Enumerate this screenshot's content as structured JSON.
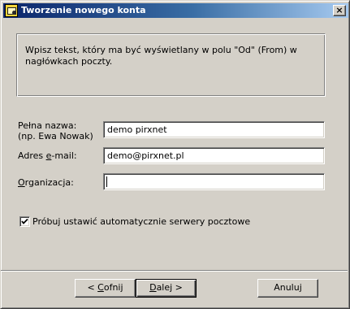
{
  "window": {
    "title": "Tworzenie nowego konta",
    "close_glyph": "×"
  },
  "info": {
    "text": "Wpisz tekst, który ma być wyświetlany w polu \"Od\" (From) w nagłówkach poczty."
  },
  "form": {
    "full_name": {
      "label_line1": "Pełna nazwa:",
      "label_line2": "(np. Ewa Nowak)",
      "value": "demo pirxnet"
    },
    "email": {
      "label_before": "Adres ",
      "label_accel": "e",
      "label_after": "-mail:",
      "value": "demo@pirxnet.pl"
    },
    "organization": {
      "label_accel": "O",
      "label_after": "rganizacja:",
      "value": ""
    }
  },
  "auto_config": {
    "checked": true,
    "label": "Próbuj ustawić automatycznie serwery pocztowe"
  },
  "buttons": {
    "back": {
      "prefix": "< ",
      "accel": "C",
      "rest": "ofnij"
    },
    "next": {
      "accel": "D",
      "rest": "alej",
      "suffix": " >"
    },
    "cancel": {
      "label": "Anuluj"
    }
  },
  "icons": {
    "app": "account-wizard-icon",
    "close": "close-icon",
    "check": "checkmark-icon"
  }
}
